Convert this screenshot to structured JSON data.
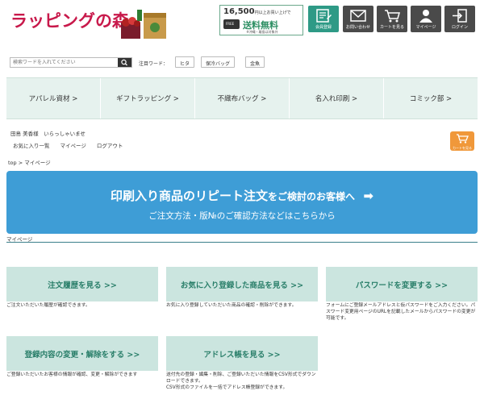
{
  "header": {
    "logo": "ラッピングの森",
    "promo": {
      "amount": "16,500",
      "amount_suffix": "円以上お買い上げで",
      "free_label": "送料無料",
      "truck_label": "FREE",
      "note": "※沖縄・離島は対象外"
    },
    "buttons": [
      {
        "label": "会員登録",
        "icon": "member-register-icon"
      },
      {
        "label": "お問い合わせ",
        "icon": "mail-icon"
      },
      {
        "label": "カートを見る",
        "icon": "cart-icon"
      },
      {
        "label": "マイページ",
        "icon": "user-icon"
      },
      {
        "label": "ログイン",
        "icon": "login-icon"
      }
    ]
  },
  "search": {
    "placeholder": "検索ワードを入れてください",
    "hot_label": "注目ワード：",
    "hot_words": [
      "ヒタ",
      "保冷バッグ",
      "金魚"
    ]
  },
  "nav": [
    "アパレル資材 >",
    "ギフトラッピング >",
    "不織布バッグ >",
    "名入れ印刷 >",
    "コミック部 >"
  ],
  "user": {
    "greeting": "田島 美香様　いらっしゃいませ",
    "links": [
      "お気に入り一覧",
      "マイページ",
      "ログアウト"
    ],
    "cart_label": "カートを見る"
  },
  "breadcrumb": "top > マイページ",
  "banner": {
    "title_a": "印刷入り商品のリピート注文",
    "title_b": "をご検討のお客様へ",
    "arrow": "➡",
    "subtitle": "ご注文方法・版№のご確認方法などはこちらから"
  },
  "section_label": "マイページ",
  "cards": [
    {
      "title": "注文履歴を見る >>",
      "desc": "ご注文いただいた履歴が確認できます。"
    },
    {
      "title": "お気に入り登録した商品を見る >>",
      "desc": "お気に入り登録していただいた商品の確認・削除ができます。"
    },
    {
      "title": "パスワードを変更する >>",
      "desc": "フォームにご登録メールアドレスと仮パスワードをご入力ください。パスワード変更用ページのURLを記載したメールからパスワードの変更が可能です。"
    },
    {
      "title": "登録内容の変更・解除をする >>",
      "desc": "ご登録いただいたお客様の情報が確認、変更・解除ができます"
    },
    {
      "title": "アドレス帳を見る >>",
      "desc": "送付先の登録・編集・削除、ご登録いただいた情報をCSV形式でダウンロードできます。\nCSV形式のファイルを一括でアドレス帳登録ができます。"
    }
  ],
  "colors": {
    "brand": "#c8194b",
    "accent": "#2e9a86",
    "banner": "#3e9dd6",
    "card": "#cbe5df",
    "nav_bg": "#e6f2ee",
    "cart_button": "#f0983a"
  }
}
